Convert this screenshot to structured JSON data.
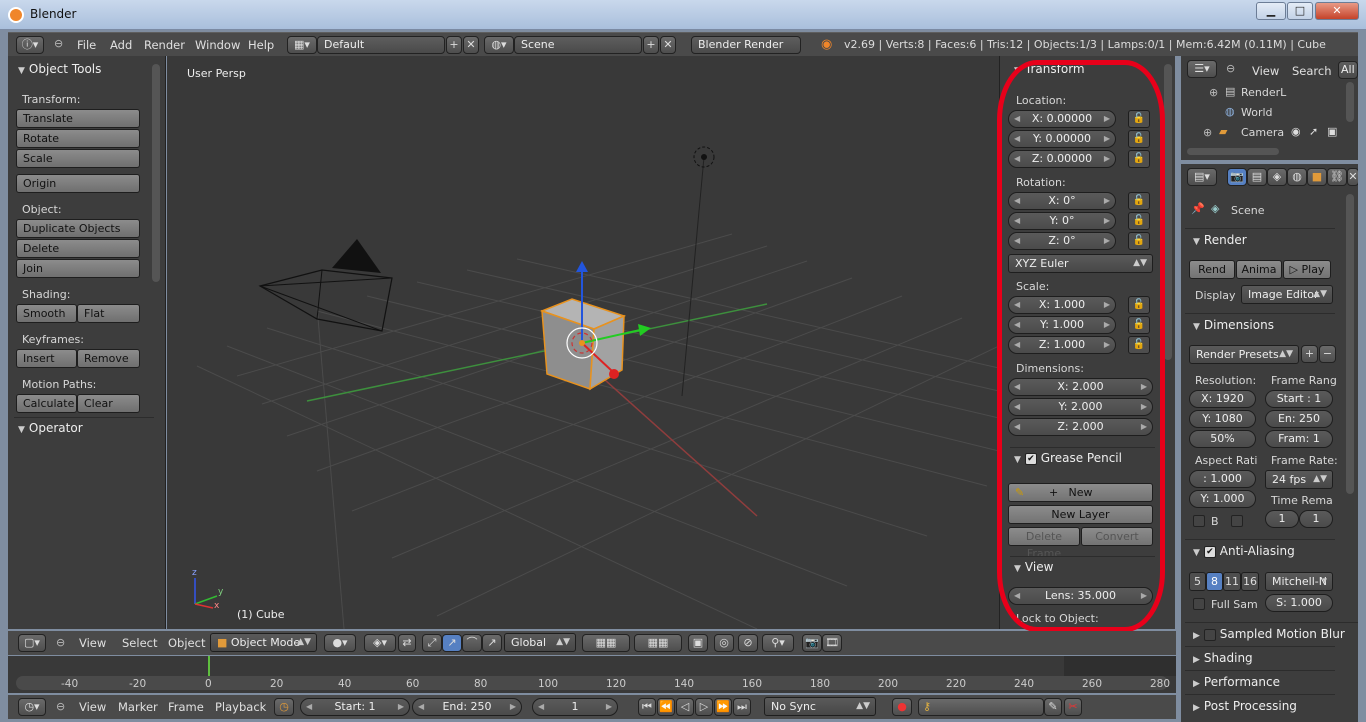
{
  "window": {
    "title": "Blender",
    "min": "▁",
    "max": "□",
    "close": "✕"
  },
  "info_header": {
    "menus": [
      "File",
      "Add",
      "Render",
      "Window",
      "Help"
    ],
    "screen_layout": "Default",
    "scene": "Scene",
    "render_engine": "Blender Render",
    "stats": "v2.69 | Verts:8 | Faces:6 | Tris:12 | Objects:1/3 | Lamps:0/1 | Mem:6.42M (0.11M) | Cube"
  },
  "tool_shelf": {
    "title": "Object Tools",
    "transform_label": "Transform:",
    "translate": "Translate",
    "rotate": "Rotate",
    "scale": "Scale",
    "origin": "Origin",
    "object_label": "Object:",
    "duplicate": "Duplicate Objects",
    "delete": "Delete",
    "join": "Join",
    "shading_label": "Shading:",
    "smooth": "Smooth",
    "flat": "Flat",
    "keyframes_label": "Keyframes:",
    "insert": "Insert",
    "remove": "Remove",
    "motion_label": "Motion Paths:",
    "calculate": "Calculate",
    "clear": "Clear",
    "operator": "Operator"
  },
  "viewport": {
    "view_name": "User Persp",
    "object_label": "(1) Cube",
    "axis_x": "x",
    "axis_y": "y",
    "axis_z": "z"
  },
  "npanel": {
    "transform": "Transform",
    "location_label": "Location:",
    "loc_x": "X: 0.00000",
    "loc_y": "Y: 0.00000",
    "loc_z": "Z: 0.00000",
    "rotation_label": "Rotation:",
    "rot_x": "X: 0°",
    "rot_y": "Y: 0°",
    "rot_z": "Z: 0°",
    "rot_mode": "XYZ Euler",
    "scale_label": "Scale:",
    "sc_x": "X: 1.000",
    "sc_y": "Y: 1.000",
    "sc_z": "Z: 1.000",
    "dimensions_label": "Dimensions:",
    "dim_x": "X: 2.000",
    "dim_y": "Y: 2.000",
    "dim_z": "Z: 2.000",
    "grease_pencil": "Grease Pencil",
    "new": "New",
    "new_layer": "New Layer",
    "delete_frame": "Delete Frame",
    "convert": "Convert",
    "view": "View",
    "lens": "Lens: 35.000",
    "lock_to_object": "Lock to Object:"
  },
  "outliner": {
    "view": "View",
    "search": "Search",
    "all": "All",
    "items": [
      "RenderL",
      "World",
      "Camera"
    ]
  },
  "properties": {
    "scene": "Scene",
    "render": "Render",
    "render_btn": "Rend",
    "anim_btn": "Anima",
    "play_btn": "Play",
    "display_label": "Display",
    "display_value": "Image Editor",
    "dimensions": "Dimensions",
    "render_presets": "Render Presets",
    "resolution_label": "Resolution:",
    "frame_range_label": "Frame Rang",
    "res_x": "X: 1920",
    "res_y": "Y: 1080",
    "res_pct": "50%",
    "start": "Start : 1",
    "end": "En: 250",
    "frame": "Fram: 1",
    "aspect_label": "Aspect Rati",
    "frame_rate_label": "Frame Rate:",
    "asp_x": ": 1.000",
    "asp_y": "Y: 1.000",
    "fps": "24 fps",
    "time_remap": "Time Rema",
    "b_label": "B",
    "remap_a": "1",
    "remap_b": "1",
    "anti_aliasing": "Anti-Aliasing",
    "aa_5": "5",
    "aa_8": "8",
    "aa_11": "11",
    "aa_16": "16",
    "filter": "Mitchell-N",
    "full_sample": "Full Sam",
    "filter_size": "S: 1.000",
    "sampled_motion": "Sampled Motion Blur",
    "shading": "Shading",
    "performance": "Performance",
    "post_processing": "Post Processing"
  },
  "view3d_header": {
    "menus": [
      "View",
      "Select",
      "Object"
    ],
    "mode": "Object Mode",
    "orientation": "Global"
  },
  "timeline": {
    "ticks": [
      "-40",
      "-20",
      "0",
      "20",
      "40",
      "60",
      "80",
      "100",
      "120",
      "140",
      "160",
      "180",
      "200",
      "220",
      "240",
      "260",
      "280"
    ],
    "menus": [
      "View",
      "Marker",
      "Frame",
      "Playback"
    ],
    "start": "Start: 1",
    "end": "End: 250",
    "current": "1",
    "sync": "No Sync"
  }
}
